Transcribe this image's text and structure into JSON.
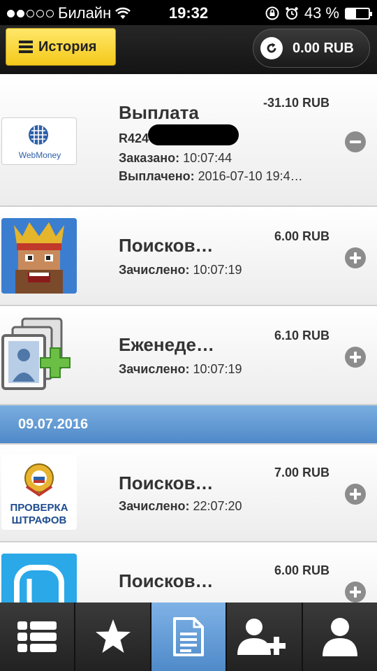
{
  "status": {
    "carrier": "Билайн",
    "time": "19:32",
    "battery_percent": "43 %",
    "battery_level": 0.43
  },
  "header": {
    "history_label": "История",
    "balance": "0.00 RUB"
  },
  "rows": [
    {
      "icon": "webmoney-logo",
      "title": "Выплата",
      "amount": "-31.10 RUB",
      "wallet_prefix": "R424",
      "ordered_label": "Заказано:",
      "ordered_value": "10:07:44",
      "paid_label": "Выплачено:",
      "paid_value": "2016-07-10 19:4…",
      "action": "minus"
    },
    {
      "icon": "king-game-icon",
      "title": "Поисков…",
      "amount": "6.00 RUB",
      "credited_label": "Зачислено:",
      "credited_value": "10:07:19",
      "action": "plus"
    },
    {
      "icon": "add-contact-cards-icon",
      "title": "Еженеде…",
      "amount": "6.10 RUB",
      "credited_label": "Зачислено:",
      "credited_value": "10:07:19",
      "action": "plus"
    }
  ],
  "date_divider": "09.07.2016",
  "rows2": [
    {
      "icon": "fines-check-logo",
      "logo_text_1": "ПРОВЕРКА",
      "logo_text_2": "ШТРАФОВ",
      "title": "Поисков…",
      "amount": "7.00 RUB",
      "credited_label": "Зачислено:",
      "credited_value": "22:07:20",
      "action": "plus"
    },
    {
      "icon": "phone-app-icon",
      "title": "Поисков…",
      "amount": "6.00 RUB",
      "action": "plus"
    }
  ],
  "tabs": [
    {
      "icon": "list-icon",
      "active": false
    },
    {
      "icon": "star-icon",
      "active": false
    },
    {
      "icon": "document-icon",
      "active": true
    },
    {
      "icon": "add-user-icon",
      "active": false
    },
    {
      "icon": "user-icon",
      "active": false
    }
  ]
}
